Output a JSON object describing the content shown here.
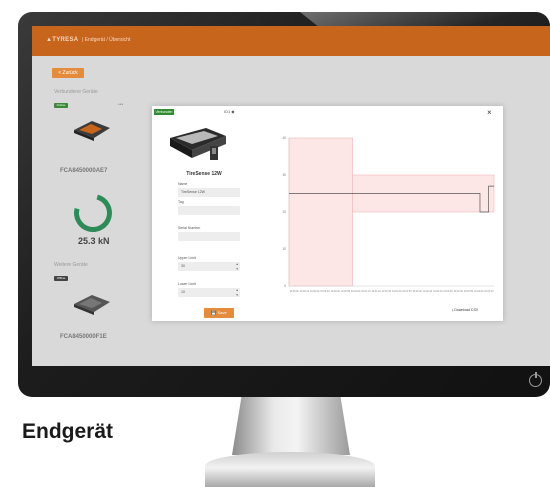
{
  "caption": "Endgerät",
  "app": {
    "brand": "▲TYRESA",
    "breadcrumb": "| Endgerät / Übersicht",
    "back_label": "< Zurück",
    "section1_label": "Verbundene Geräte",
    "section2_label": "Weitere Geräte",
    "device1": {
      "badge": "Online",
      "name": "FCA8450000AE7"
    },
    "device2": {
      "badge": "Offline",
      "name": "FCA8450000F1E"
    },
    "gauge_value": "25.3 kN",
    "colors": {
      "accent": "#c8651d",
      "button": "#e48b3c",
      "ok": "#2e8b57"
    }
  },
  "modal": {
    "badge": "Verbunden",
    "title": "ID1 ◆",
    "close_label": "×",
    "product_name": "TireSense 12W",
    "fields": [
      {
        "label": "Name",
        "value": "TireSense 12W",
        "dim": false
      },
      {
        "label": "Tag",
        "value": "",
        "dim": true
      },
      {
        "label": "Serial Number",
        "value": "",
        "dim": true
      },
      {
        "label": "Upper Limit",
        "value": "30",
        "dim": false
      },
      {
        "label": "Lower Limit",
        "value": "10",
        "dim": false
      }
    ],
    "save_label": "💾 Save",
    "download_label": "⤓ Download CSV"
  },
  "chart_data": {
    "type": "line",
    "yticks": [
      "40",
      "30",
      "20",
      "10",
      "0"
    ],
    "ylim": [
      0,
      40
    ],
    "xticks": [
      "10:00:00",
      "10:00:10",
      "10:00:20",
      "10:00:30",
      "10:00:40",
      "10:00:50",
      "10:01:00",
      "10:01:10",
      "10:01:20",
      "10:01:30",
      "10:01:40",
      "10:01:50",
      "10:02:00",
      "10:02:10",
      "10:02:20",
      "10:02:30",
      "10:02:40",
      "10:02:50",
      "10:03:00",
      "10:03:10"
    ],
    "series": [
      {
        "x": [
          0,
          59,
          59,
          177,
          177,
          185,
          185,
          190
        ],
        "values": [
          25,
          25,
          25,
          25,
          20,
          20,
          27,
          27
        ]
      }
    ],
    "band": [
      {
        "x0": 0,
        "x1": 59,
        "y0": 0,
        "y1": 40
      },
      {
        "x0": 59,
        "x1": 190,
        "y0": 20,
        "y1": 30
      }
    ],
    "colors": {
      "band_fill": "#fde6e6",
      "band_stroke": "#f2b8b8",
      "line": "#555555"
    }
  }
}
